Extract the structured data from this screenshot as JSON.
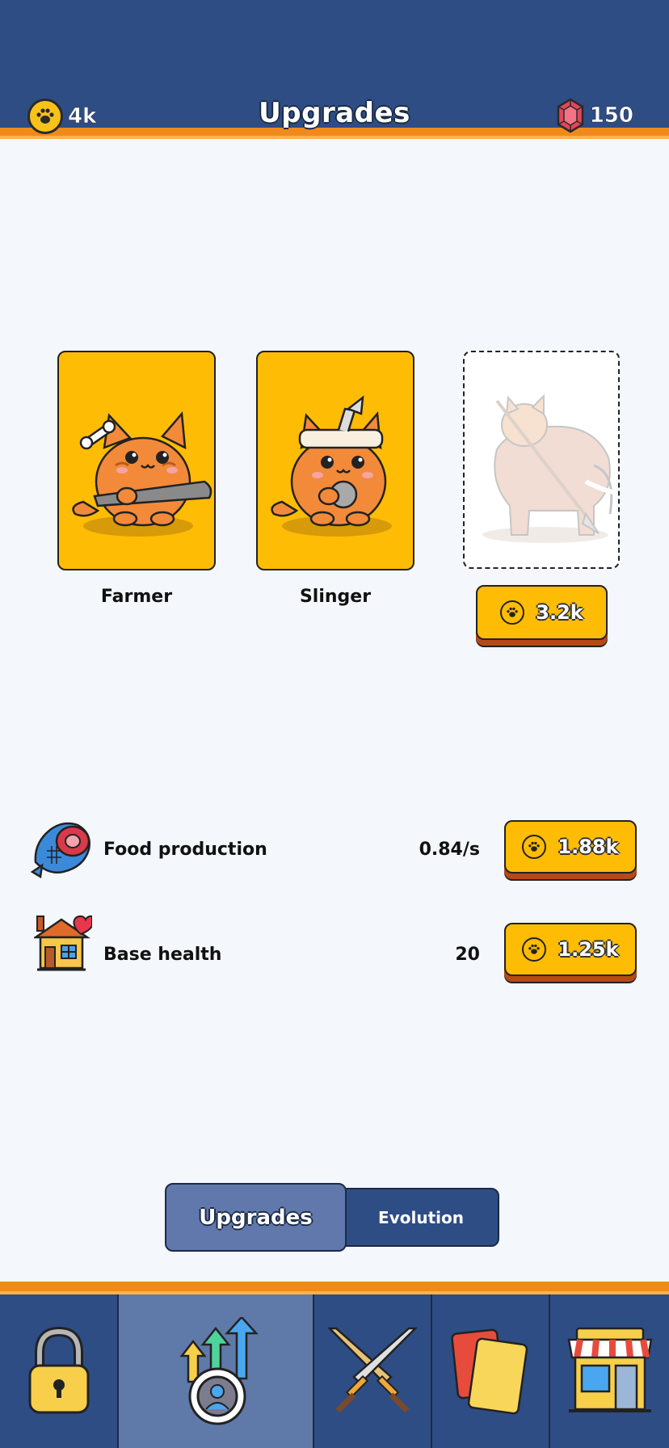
{
  "header": {
    "title": "Upgrades",
    "coins": "4k",
    "gems": "150",
    "coin_icon": "paw-coin-icon",
    "gem_icon": "red-gem-icon"
  },
  "units": [
    {
      "label": "Farmer",
      "icon": "cat-farmer-with-club"
    },
    {
      "label": "Slinger",
      "icon": "cat-slinger-with-stone"
    },
    {
      "label": "",
      "icon": "cat-riding-mammoth-locked",
      "price": "3.2k"
    }
  ],
  "stats": [
    {
      "label": "Food production",
      "value": "0.84/s",
      "price": "1.88k",
      "icon": "meat-fish-icon"
    },
    {
      "label": "Base health",
      "value": "20",
      "price": "1.25k",
      "icon": "house-heart-icon"
    }
  ],
  "tabs": [
    {
      "label": "Upgrades",
      "active": true
    },
    {
      "label": "Evolution",
      "active": false
    }
  ],
  "nav": [
    {
      "icon": "lock-icon",
      "active": false
    },
    {
      "icon": "upgrade-arrows-icon",
      "active": true
    },
    {
      "icon": "crossed-swords-icon",
      "active": false
    },
    {
      "icon": "cards-icon",
      "active": false
    },
    {
      "icon": "shop-icon",
      "active": false
    }
  ],
  "colors": {
    "header_bg": "#2e4d85",
    "accent_orange": "#f08a1c",
    "gold": "#ffbc05",
    "page_bg": "#f4f7fc",
    "active_tab": "#6178ad"
  }
}
